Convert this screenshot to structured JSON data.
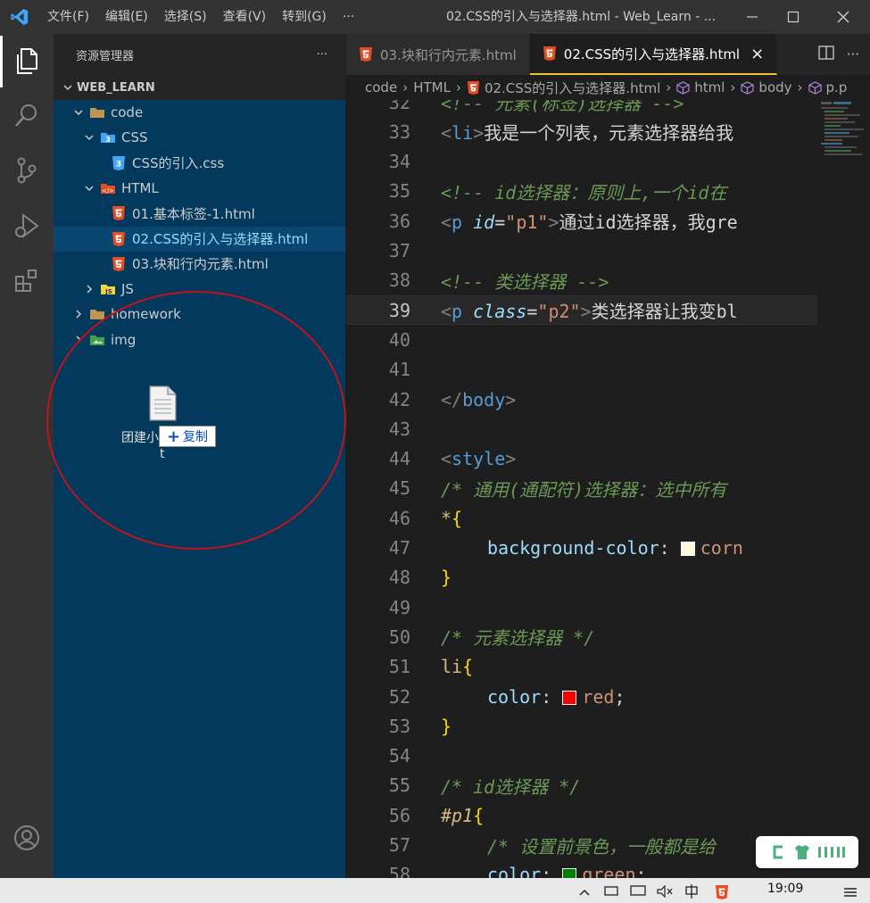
{
  "titlebar": {
    "menu": [
      "文件(F)",
      "编辑(E)",
      "选择(S)",
      "查看(V)",
      "转到(G)",
      "···"
    ],
    "title": "02.CSS的引入与选择器.html - Web_Learn - ..."
  },
  "sidebar": {
    "header": "资源管理器",
    "more": "···",
    "section": "WEB_LEARN",
    "tree": [
      {
        "label": "code",
        "depth": 1,
        "type": "folder",
        "open": true
      },
      {
        "label": "CSS",
        "depth": 2,
        "type": "css-folder",
        "open": true
      },
      {
        "label": "CSS的引入.css",
        "depth": 3,
        "type": "css-file"
      },
      {
        "label": "HTML",
        "depth": 2,
        "type": "html-folder",
        "open": true
      },
      {
        "label": "01.基本标签-1.html",
        "depth": 3,
        "type": "html-file"
      },
      {
        "label": "02.CSS的引入与选择器.html",
        "depth": 3,
        "type": "html-file",
        "selected": true
      },
      {
        "label": "03.块和行内元素.html",
        "depth": 3,
        "type": "html-file"
      },
      {
        "label": "JS",
        "depth": 2,
        "type": "js-folder",
        "open": false
      },
      {
        "label": "homework",
        "depth": 1,
        "type": "folder",
        "open": false
      },
      {
        "label": "img",
        "depth": 1,
        "type": "img-folder",
        "open": false
      }
    ]
  },
  "drag": {
    "file_label": "团建小",
    "file_tail": "t",
    "copy_label": "复制",
    "copy_symbol": "+"
  },
  "tabs": [
    {
      "label": "03.块和行内元素.html",
      "active": false
    },
    {
      "label": "02.CSS的引入与选择器.html",
      "active": true
    }
  ],
  "tab_close": "×",
  "tab_more": "···",
  "breadcrumb": [
    "code",
    "HTML",
    "02.CSS的引入与选择器.html",
    "html",
    "body",
    "p.p"
  ],
  "editor": {
    "current_line": 39,
    "lines": [
      {
        "n": 32,
        "html": "<span class=\"cmt\">&lt;!-- 元素(标签)选择器 --&gt;</span>"
      },
      {
        "n": 33,
        "html": "<span class=\"tag-br\">&lt;</span><span class=\"tag\">li</span><span class=\"tag-br\">&gt;</span><span class=\"txt\">我是一个列表，元素选择器给我</span>"
      },
      {
        "n": 34,
        "html": ""
      },
      {
        "n": 35,
        "html": "<span class=\"cmt\">&lt;!-- id选择器：原则上,一个id在</span>"
      },
      {
        "n": 36,
        "html": "<span class=\"tag-br\">&lt;</span><span class=\"tag\">p</span> <span class=\"attr\" style=\"font-style:italic\">id</span><span class=\"txt\">=</span><span class=\"str\">\"p1\"</span><span class=\"tag-br\">&gt;</span><span class=\"txt\">通过id选择器，我gre</span>"
      },
      {
        "n": 37,
        "html": ""
      },
      {
        "n": 38,
        "html": "<span class=\"cmt\">&lt;!-- 类选择器 --&gt;</span>"
      },
      {
        "n": 39,
        "html": "<span class=\"tag-br\">&lt;</span><span class=\"tag\">p</span> <span class=\"attr\" style=\"font-style:italic\">class</span><span class=\"txt\">=</span><span class=\"str\">\"p2\"</span><span class=\"tag-br\">&gt;</span><span class=\"txt\">类选择器让我变bl</span>"
      },
      {
        "n": 40,
        "html": ""
      },
      {
        "n": 41,
        "html": ""
      },
      {
        "n": 42,
        "html": "<span class=\"tag-br\">&lt;/</span><span class=\"tag\">body</span><span class=\"tag-br\">&gt;</span>",
        "indent": 0
      },
      {
        "n": 43,
        "html": ""
      },
      {
        "n": 44,
        "html": "<span class=\"tag-br\">&lt;</span><span class=\"tag\">style</span><span class=\"tag-br\">&gt;</span>",
        "indent": 0
      },
      {
        "n": 45,
        "html": "<span class=\"cmt\">/* 通用(通配符)选择器：选中所有</span>"
      },
      {
        "n": 46,
        "html": "<span class=\"sel\">*</span><span class=\"brace\">{</span>"
      },
      {
        "n": 47,
        "html": "<span class=\"prop\">background-color</span><span class=\"txt\">: </span><span class=\"swatch\" style=\"background:#fff8dc\"></span><span class=\"val\">corn</span>",
        "indent": 2
      },
      {
        "n": 48,
        "html": "<span class=\"brace\">}</span>"
      },
      {
        "n": 49,
        "html": ""
      },
      {
        "n": 50,
        "html": "<span class=\"cmt\">/* 元素选择器 */</span>"
      },
      {
        "n": 51,
        "html": "<span class=\"sel\">li</span><span class=\"brace\">{</span>"
      },
      {
        "n": 52,
        "html": "<span class=\"prop\">color</span><span class=\"txt\">: </span><span class=\"swatch\" style=\"background:#ff0000\"></span><span class=\"val\">red</span><span class=\"txt\">;</span>",
        "indent": 2
      },
      {
        "n": 53,
        "html": "<span class=\"brace\">}</span>"
      },
      {
        "n": 54,
        "html": ""
      },
      {
        "n": 55,
        "html": "<span class=\"cmt\">/* id选择器 */</span>"
      },
      {
        "n": 56,
        "html": "<span class=\"sel\" style=\"font-style:italic\">#p1</span><span class=\"brace\">{</span>"
      },
      {
        "n": 57,
        "html": "<span class=\"cmt\">/* 设置前景色，一般都是给</span>",
        "indent": 2
      },
      {
        "n": 58,
        "html": "<span class=\"prop\">color</span><span class=\"txt\">: </span><span class=\"swatch\" style=\"background:#008000\"></span><span class=\"val\">green</span><span class=\"txt\">;</span>",
        "indent": 2
      }
    ]
  },
  "taskbar": {
    "clock": "19:09"
  },
  "colors": {
    "title_bg": "#333333",
    "sidebar_bg": "#04395e",
    "selected_bg": "#094771",
    "editor_bg": "#1e1e1e",
    "accent": "#f1c232",
    "drag_ring": "#c0141c"
  }
}
